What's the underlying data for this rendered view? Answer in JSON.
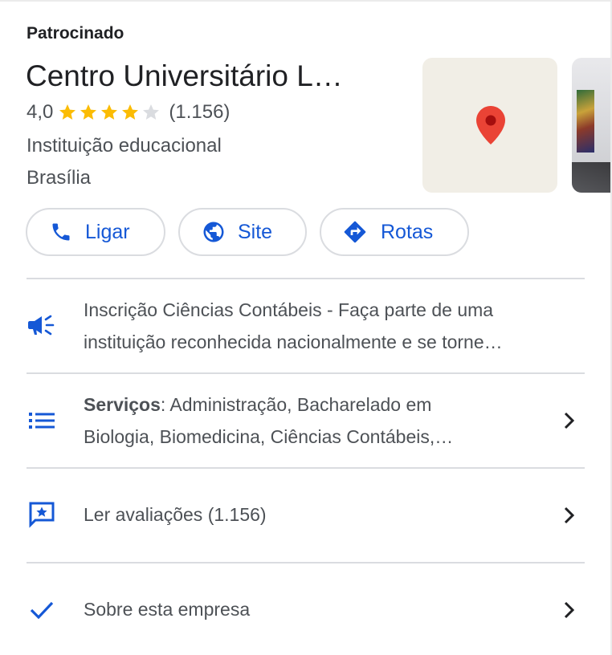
{
  "card": {
    "sponsored_label": "Patrocinado",
    "title": "Centro Universitário L…",
    "rating": "4,0",
    "stars_filled": 4,
    "stars_total": 5,
    "review_count": "(1.156)",
    "category": "Instituição educacional",
    "location": "Brasília"
  },
  "actions": {
    "call_label": "Ligar",
    "site_label": "Site",
    "route_label": "Rotas"
  },
  "rows": {
    "ad_line1": "Inscrição Ciências Contábeis - Faça parte de uma",
    "ad_line2": "instituição reconhecida nacionalmente e se torne…",
    "services_label": "Serviços",
    "services_line1": ": Administração, Bacharelado em",
    "services_line2": "Biologia, Biomedicina, Ciências Contábeis,…",
    "reviews_label": "Ler avaliações (1.156)",
    "about_label": "Sobre esta empresa"
  },
  "icons": {
    "call": "phone-icon",
    "site": "globe-icon",
    "route": "directions-icon",
    "ad": "megaphone-icon",
    "services": "list-icon",
    "reviews": "review-star-icon",
    "about": "checkmark-icon",
    "chevron": "chevron-right-icon",
    "map_pin": "map-pin-icon"
  },
  "colors": {
    "accent_blue": "#1558d6",
    "star_gold": "#fbbc04",
    "star_empty": "#dadce0",
    "pin_red": "#ea4335",
    "map_bg": "#f1eee6"
  }
}
